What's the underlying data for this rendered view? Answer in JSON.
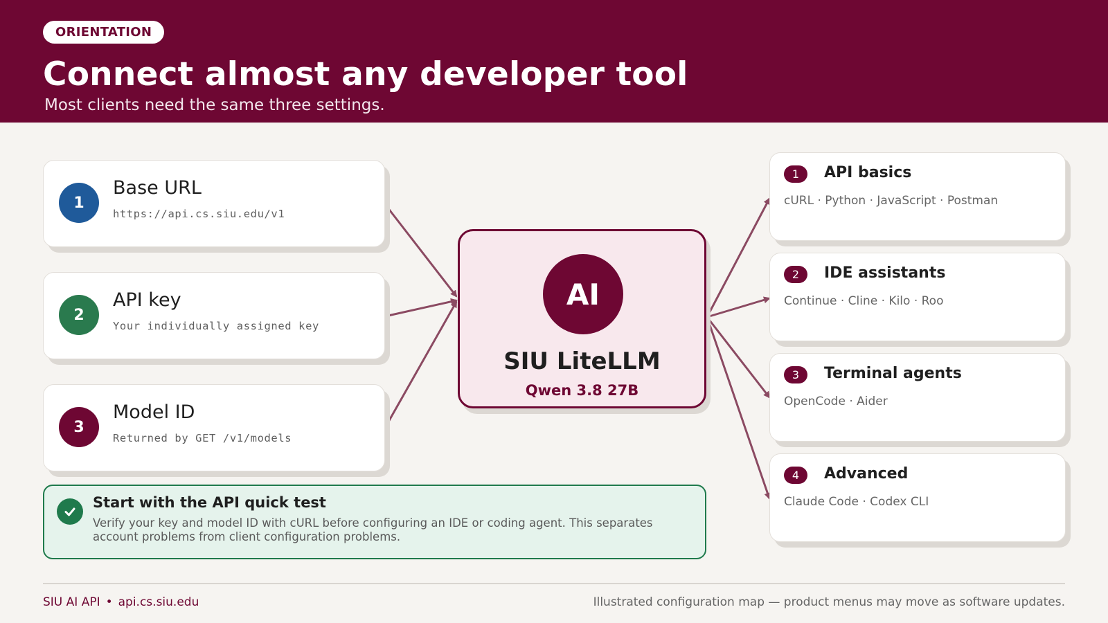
{
  "header": {
    "badge": "ORIENTATION",
    "title": "Connect almost any developer tool",
    "subtitle": "Most clients need the same three settings."
  },
  "settings": [
    {
      "number": "1",
      "title": "Base URL",
      "value": "https://api.cs.siu.edu/v1",
      "color": "#1f5a9a"
    },
    {
      "number": "2",
      "title": "API key",
      "value": "Your individually assigned key",
      "color": "#2a7a4e"
    },
    {
      "number": "3",
      "title": "Model ID",
      "value": "Returned by GET /v1/models",
      "color": "#6e0733"
    }
  ],
  "hub": {
    "icon_text": "AI",
    "name": "SIU LiteLLM",
    "model": "Qwen 3.8 27B"
  },
  "clients": [
    {
      "number": "1",
      "title": "API basics",
      "tools": "cURL · Python · JavaScript · Postman"
    },
    {
      "number": "2",
      "title": "IDE assistants",
      "tools": "Continue · Cline · Kilo · Roo"
    },
    {
      "number": "3",
      "title": "Terminal agents",
      "tools": "OpenCode · Aider"
    },
    {
      "number": "4",
      "title": "Advanced",
      "tools": "Claude Code · Codex CLI"
    }
  ],
  "tip": {
    "icon": "check-icon",
    "title": "Start with the API quick test",
    "body": "Verify your key and model ID with cURL before configuring an IDE or coding agent. This separates account problems from client configuration problems."
  },
  "footer": {
    "brand": "SIU AI API",
    "separator": "•",
    "domain": "api.cs.siu.edu",
    "note": "Illustrated configuration map — product menus may move as software updates."
  },
  "colors": {
    "brand": "#6e0733",
    "blue": "#1f5a9a",
    "green": "#2a7a4e",
    "arrow": "#8b4a62",
    "tip_border": "#1f7a4c"
  }
}
